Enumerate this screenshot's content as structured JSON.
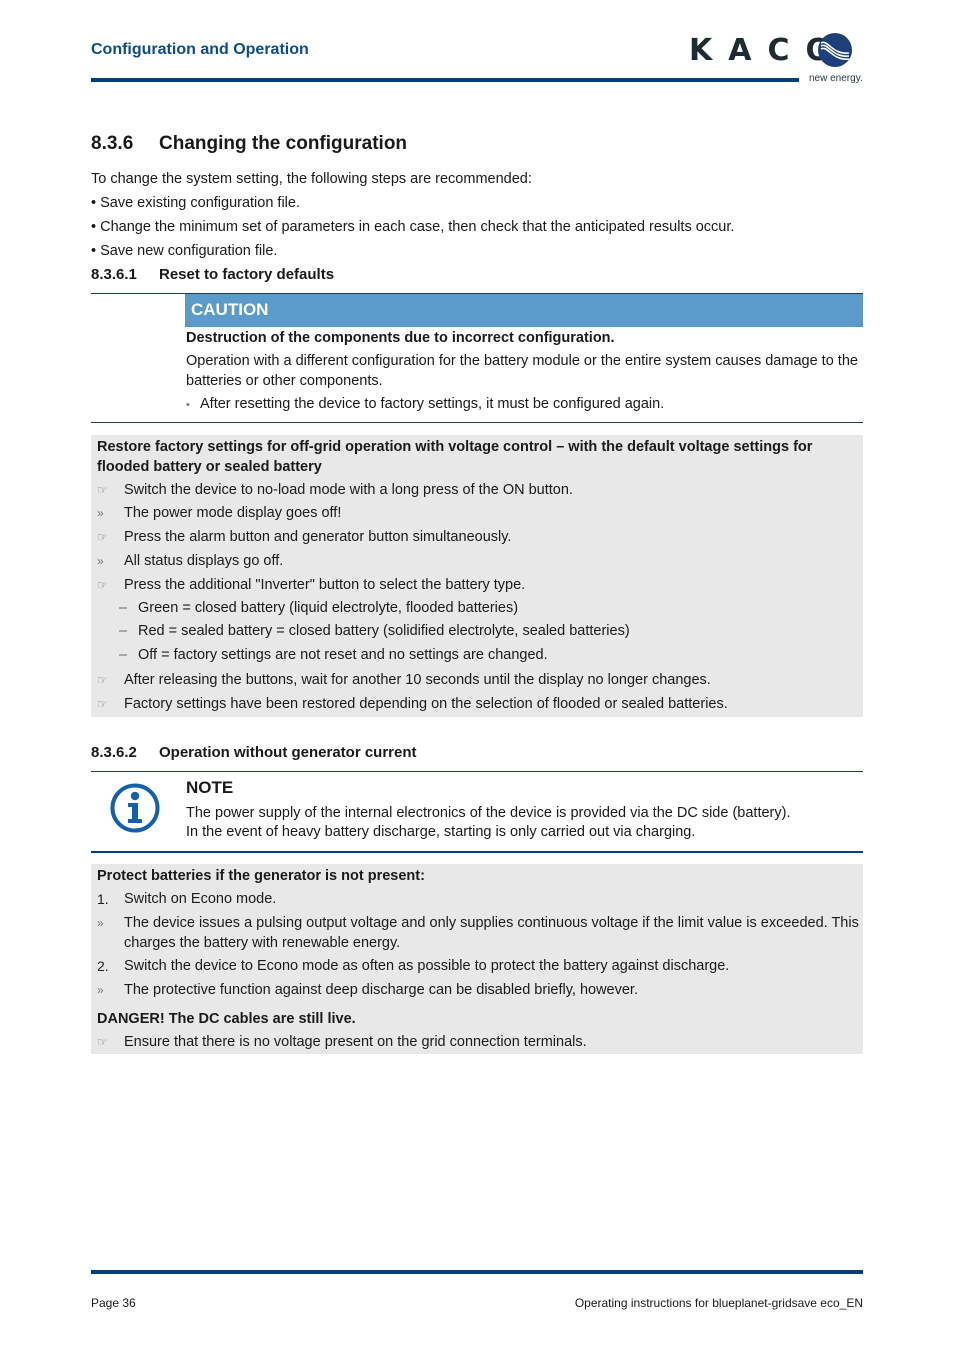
{
  "header": {
    "section_title": "Configuration and Operation",
    "logo_text": "KACO",
    "logo_tagline": "new energy.",
    "brand_color": "#003f7f"
  },
  "section": {
    "number": "8.3.6",
    "title": "Changing the configuration",
    "intro": "To change the system setting, the following steps are recommended:",
    "bullets": [
      "• Save existing configuration file.",
      "• Change the minimum set of parameters in each case, then check that the anticipated results occur.",
      "• Save new configuration file."
    ]
  },
  "sub1": {
    "number": "8.3.6.1",
    "title": "Reset to factory defaults",
    "caution": {
      "label": "CAUTION",
      "color": "#5b9bc9",
      "headline": "Destruction of the components due to incorrect configuration.",
      "body": "Operation with a different configuration for the battery module or the entire system causes damage to the batteries or other components.",
      "bullet_marker": "•",
      "bullet": "After resetting the device to factory settings, it must be configured again."
    },
    "procedure": {
      "title": "Restore factory settings for off-grid operation with voltage control – with the default voltage settings for flooded battery or sealed battery",
      "steps": [
        {
          "marker": "☞",
          "text": "Switch the device to no-load mode with a long press of the ON button."
        },
        {
          "marker": "»",
          "text": "The power mode display goes off!"
        },
        {
          "marker": "☞",
          "text": "Press the alarm button and generator button simultaneously."
        },
        {
          "marker": "»",
          "text": "All status displays go off."
        },
        {
          "marker": "☞",
          "text": "Press the additional \"Inverter\" button to select the battery type."
        }
      ],
      "options": [
        {
          "marker": "–",
          "text": "Green = closed battery (liquid electrolyte, flooded batteries)"
        },
        {
          "marker": "–",
          "text": "Red = sealed battery =  closed battery (solidified electrolyte, sealed batteries)"
        },
        {
          "marker": "–",
          "text": "Off = factory settings are not reset and no settings are changed."
        }
      ],
      "final_steps": [
        {
          "marker": "☞",
          "text": "After releasing the buttons, wait for another 10 seconds until the display no longer changes."
        },
        {
          "marker": "☞",
          "text": "Factory settings have been restored depending on the selection of flooded or sealed batteries."
        }
      ]
    }
  },
  "sub2": {
    "number": "8.3.6.2",
    "title": "Operation without generator current",
    "note": {
      "label": "NOTE",
      "icon": "info-icon",
      "line1": "The power supply of the internal electronics of the device is provided via the DC side (battery).",
      "line2": "In the event of heavy battery discharge, starting is only carried out via charging."
    },
    "procedure": {
      "title": "Protect batteries if the generator is not present:",
      "steps": [
        {
          "marker": "1.",
          "text": "Switch on Econo mode."
        },
        {
          "marker": "»",
          "text": "The device issues a pulsing output voltage and only supplies continuous voltage if the limit value is exceeded. This charges the battery with renewable energy."
        },
        {
          "marker": "2.",
          "text": "Switch the device to Econo mode as often as possible to protect the battery against discharge."
        },
        {
          "marker": "»",
          "text": "The protective function against deep discharge can be disabled briefly, however."
        }
      ],
      "danger": "DANGER! The DC cables are still live.",
      "danger_step": {
        "marker": "☞",
        "text": "Ensure that there is no voltage present on the grid connection terminals."
      }
    }
  },
  "footer": {
    "page": "Page 36",
    "doc_title": "Operating instructions for blueplanet-gridsave eco_EN"
  }
}
